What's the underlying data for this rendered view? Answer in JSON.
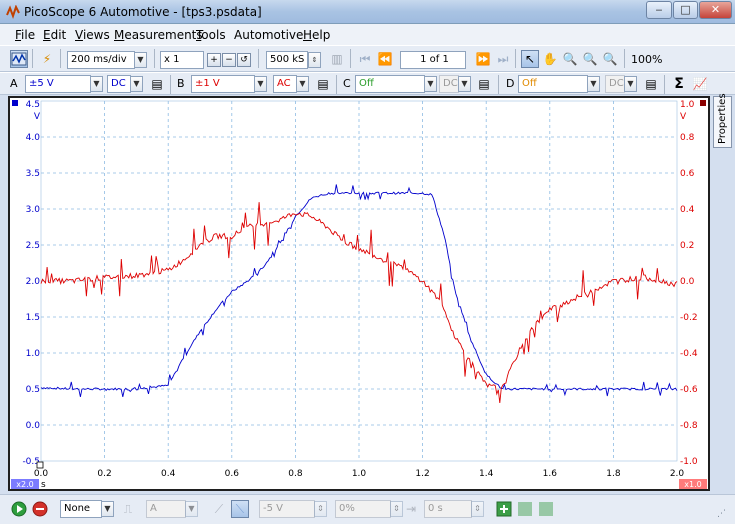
{
  "window": {
    "title": "PicoScope 6 Automotive - [tps3.psdata]",
    "minimize": "‒",
    "maximize": "□",
    "close": "✕"
  },
  "menu": [
    {
      "key": "F",
      "rest": "ile"
    },
    {
      "key": "E",
      "rest": "dit"
    },
    {
      "key": "V",
      "rest": "iews"
    },
    {
      "key": "M",
      "rest": "easurements"
    },
    {
      "key": "T",
      "rest": "ools"
    },
    {
      "key": "",
      "rest": "Automotive"
    },
    {
      "key": "H",
      "rest": "elp"
    }
  ],
  "toolbar": {
    "timebase": "200 ms/div",
    "zoom": "x 1",
    "samples": "500 kS",
    "buffer": "1 of 1",
    "zoom_percent": "100%"
  },
  "channels": {
    "a": {
      "label": "A",
      "range": "±5 V",
      "coupling": "DC",
      "color": "#0000cc"
    },
    "b": {
      "label": "B",
      "range": "±1 V",
      "coupling": "AC",
      "color": "#dd0000"
    },
    "c": {
      "label": "C",
      "range": "Off",
      "coupling": "DC",
      "color": "#2a9d2a"
    },
    "d": {
      "label": "D",
      "range": "Off",
      "coupling": "DC",
      "color": "#e08a00"
    },
    "sigma": "Σ"
  },
  "properties_tab": "Properties",
  "status": {
    "trigger_mode": "None",
    "channel": "A",
    "threshold": "-5 V",
    "pretrigger": "0%",
    "delay": "0 s"
  },
  "chart_data": {
    "type": "line",
    "xlabel": "s",
    "xlim": [
      0,
      2.0
    ],
    "x_ticks": [
      "0.0",
      "0.2",
      "0.4",
      "0.6",
      "0.8",
      "1.0",
      "1.2",
      "1.4",
      "1.6",
      "1.8",
      "2.0"
    ],
    "left_axis": {
      "unit": "V",
      "top_label": "4.5",
      "ticks": [
        "4.0",
        "3.5",
        "3.0",
        "2.5",
        "2.0",
        "1.5",
        "1.0",
        "0.5",
        "0.0",
        "-0.5"
      ],
      "ylim": [
        -0.5,
        4.5
      ],
      "zoom_badge": "x2.0"
    },
    "right_axis": {
      "unit": "V",
      "top_label": "1.0",
      "ticks": [
        "0.8",
        "0.6",
        "0.4",
        "0.2",
        "0.0",
        "-0.2",
        "-0.4",
        "-0.6",
        "-0.8",
        "-1.0"
      ],
      "ylim": [
        -1.0,
        1.0
      ],
      "zoom_badge": "x1.0"
    },
    "grid": true,
    "series": [
      {
        "channel": "A",
        "color": "#0000cc",
        "axis": "left",
        "x": [
          0,
          0.1,
          0.2,
          0.3,
          0.4,
          0.45,
          0.5,
          0.55,
          0.6,
          0.65,
          0.7,
          0.75,
          0.8,
          0.85,
          0.9,
          1.0,
          1.1,
          1.2,
          1.23,
          1.27,
          1.3,
          1.35,
          1.4,
          1.45,
          1.5,
          1.6,
          1.7,
          1.8,
          1.9,
          2.0
        ],
        "values": [
          0.52,
          0.5,
          0.5,
          0.5,
          0.55,
          0.95,
          1.3,
          1.6,
          1.85,
          2.0,
          2.2,
          2.5,
          2.9,
          3.15,
          3.22,
          3.22,
          3.22,
          3.22,
          3.2,
          2.6,
          1.9,
          1.2,
          0.7,
          0.5,
          0.5,
          0.5,
          0.5,
          0.5,
          0.5,
          0.5
        ]
      },
      {
        "channel": "B",
        "color": "#dd0000",
        "axis": "right",
        "x": [
          0,
          0.1,
          0.2,
          0.3,
          0.4,
          0.45,
          0.5,
          0.55,
          0.6,
          0.65,
          0.7,
          0.75,
          0.8,
          0.85,
          0.9,
          0.95,
          1.0,
          1.05,
          1.1,
          1.15,
          1.2,
          1.25,
          1.3,
          1.35,
          1.4,
          1.45,
          1.5,
          1.55,
          1.6,
          1.7,
          1.8,
          1.9,
          2.0
        ],
        "values": [
          0.0,
          0.0,
          0.02,
          0.03,
          0.06,
          0.12,
          0.2,
          0.25,
          0.25,
          0.3,
          0.32,
          0.34,
          0.38,
          0.36,
          0.3,
          0.22,
          0.18,
          0.14,
          0.1,
          0.06,
          0.0,
          -0.1,
          -0.3,
          -0.45,
          -0.58,
          -0.6,
          -0.4,
          -0.25,
          -0.16,
          -0.08,
          0.0,
          0.02,
          -0.02
        ]
      }
    ]
  }
}
